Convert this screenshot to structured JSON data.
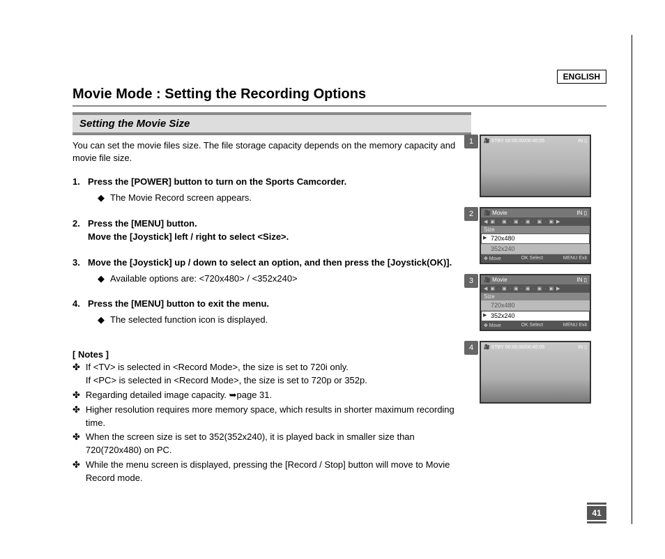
{
  "lang_badge": "ENGLISH",
  "title": "Movie Mode : Setting the Recording Options",
  "subhead": "Setting the Movie Size",
  "intro": "You can set the movie files size. The file storage capacity depends on the memory capacity and movie file size.",
  "steps": {
    "s1": {
      "main": "Press the [POWER] button to turn on the Sports Camcorder.",
      "sub1": "The Movie Record screen appears."
    },
    "s2": {
      "line1": "Press the [MENU] button.",
      "line2": "Move the [Joystick] left / right to select <Size>."
    },
    "s3": {
      "main": "Move the [Joystick] up / down to select an option, and then press the [Joystick(OK)].",
      "sub1": "Available options are: <720x480> / <352x240>"
    },
    "s4": {
      "main": "Press the [MENU] button to exit the menu.",
      "sub1": "The selected function icon is displayed."
    }
  },
  "notes_head": "[ Notes ]",
  "notes": {
    "n1a": "If <TV> is selected in <Record Mode>, the size is set to 720i only.",
    "n1b": "If <PC> is selected in <Record Mode>, the size is set to 720p or 352p.",
    "n2": "Regarding detailed image capacity. ➥page 31.",
    "n3": "Higher resolution requires more memory space, which results in shorter maximum recording time.",
    "n4": "When the screen size is set to 352(352x240), it is played back in smaller size than 720(720x480) on PC.",
    "n5": "While the menu screen is displayed, pressing the [Record / Stop] button will move to Movie Record mode."
  },
  "figs": {
    "f1": {
      "tab": "1",
      "top_left": "🎥  STBY 00:00:00/00:40:05",
      "top_right": "IN ▯"
    },
    "f2": {
      "tab": "2",
      "head_l": "🎥 Movie",
      "head_r": "IN ▯",
      "icons": "◀ ▣ · ▣ · ▣ · ▣ · ▣ · ▣ ▶",
      "sizelbl": "Size",
      "opt1": "720x480",
      "opt2": "352x240",
      "foot_l": "✥ Move",
      "foot_m": "OK Select",
      "foot_r": "MENU Exit"
    },
    "f3": {
      "tab": "3",
      "head_l": "🎥 Movie",
      "head_r": "IN ▯",
      "icons": "◀ ▣ · ▣ · ▣ · ▣ · ▣ · ▣ ▶",
      "sizelbl": "Size",
      "opt1": "720x480",
      "opt2": "352x240",
      "foot_l": "✥ Move",
      "foot_m": "OK Select",
      "foot_r": "MENU Exit"
    },
    "f4": {
      "tab": "4",
      "top_left": "🎥  STBY 00:00:00/00:40:05",
      "top_right": "IN ▯"
    }
  },
  "page_num": "41"
}
